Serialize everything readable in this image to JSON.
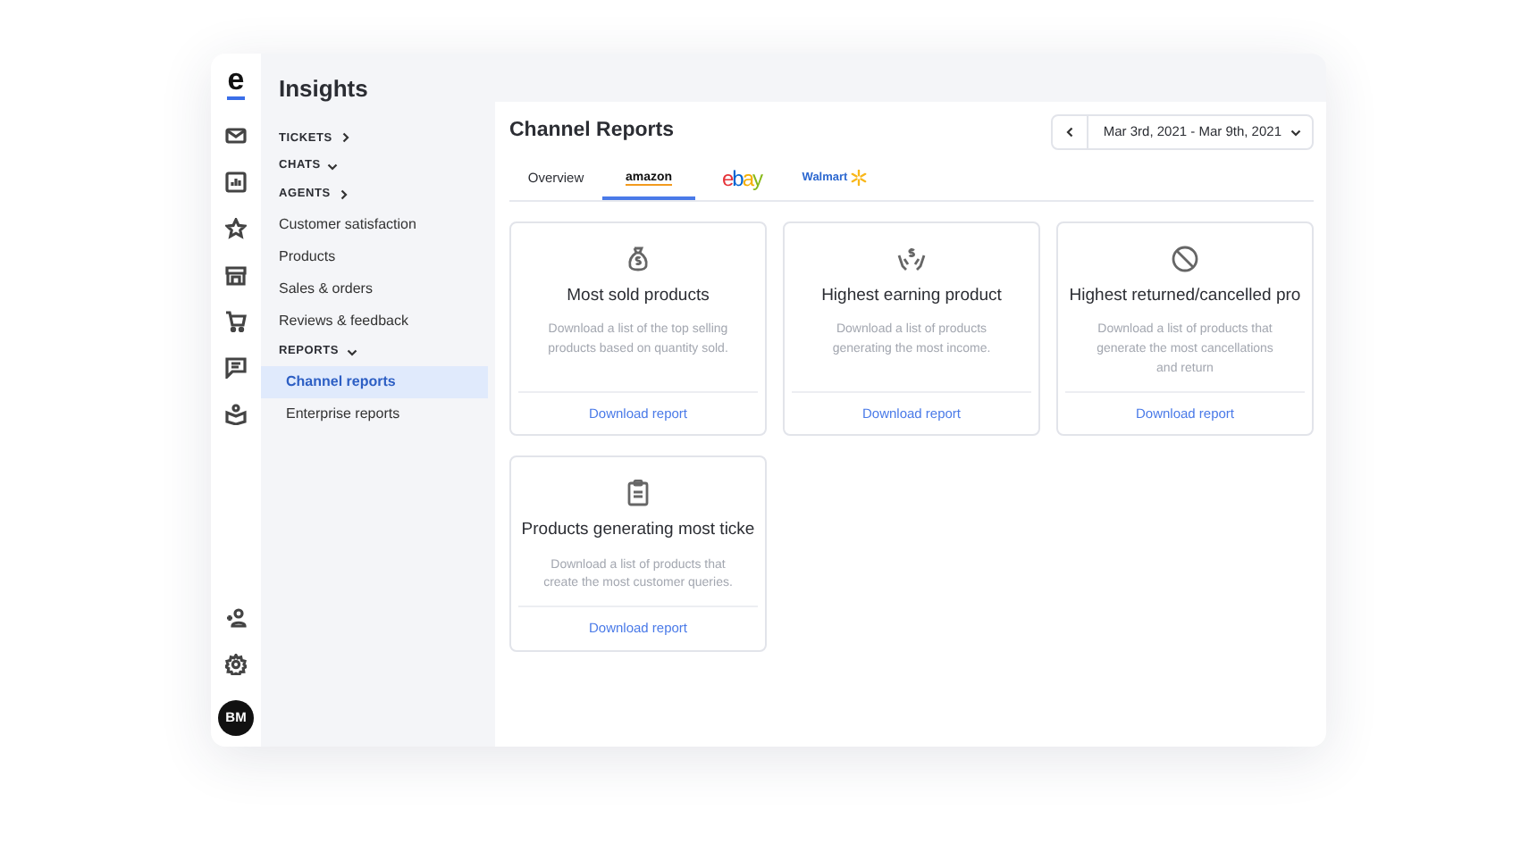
{
  "rail": {
    "logo": "e",
    "avatar": "BM"
  },
  "sidebar": {
    "title": "Insights",
    "items": [
      {
        "kind": "group",
        "label": "TICKETS",
        "expanded": false
      },
      {
        "kind": "group",
        "label": "CHATS",
        "expanded": true
      },
      {
        "kind": "group",
        "label": "AGENTS",
        "expanded": false
      },
      {
        "kind": "link",
        "label": "Customer satisfaction",
        "selected": false
      },
      {
        "kind": "link",
        "label": "Products",
        "selected": false
      },
      {
        "kind": "link",
        "label": "Sales & orders",
        "selected": false
      },
      {
        "kind": "link",
        "label": "Reviews & feedback",
        "selected": false
      },
      {
        "kind": "group",
        "label": "REPORTS",
        "expanded": true,
        "children": [
          {
            "kind": "link",
            "label": "Channel reports",
            "selected": true
          },
          {
            "kind": "link",
            "label": "Enterprise reports",
            "selected": false
          }
        ]
      }
    ]
  },
  "header": {
    "title": "Channel Reports",
    "date_range": "Mar 3rd, 2021 - Mar 9th, 2021"
  },
  "tabs": [
    {
      "kind": "text",
      "label": "Overview",
      "selected": false
    },
    {
      "kind": "amazon",
      "label": "amazon",
      "selected": true
    },
    {
      "kind": "ebay",
      "label": "ebay",
      "selected": false
    },
    {
      "kind": "walmart",
      "label": "Walmart",
      "selected": false
    }
  ],
  "reports": [
    {
      "kind": "money-bag",
      "title": "Most sold products",
      "description": "Download a list of the top selling products based on quantity sold.",
      "link": "Download report"
    },
    {
      "kind": "hands-dollar",
      "title": "Highest earning product",
      "description": "Download a list of products generating the most income.",
      "link": "Download report"
    },
    {
      "kind": "prohibited",
      "title": "Highest returned/cancelled pro",
      "description": "Download a list of products that generate the most cancellations and return",
      "link": "Download report"
    },
    {
      "kind": "clipboard",
      "title": "Products generating most ticke",
      "description": "Download a list of products that create the most customer queries.",
      "link": "Download report"
    }
  ]
}
